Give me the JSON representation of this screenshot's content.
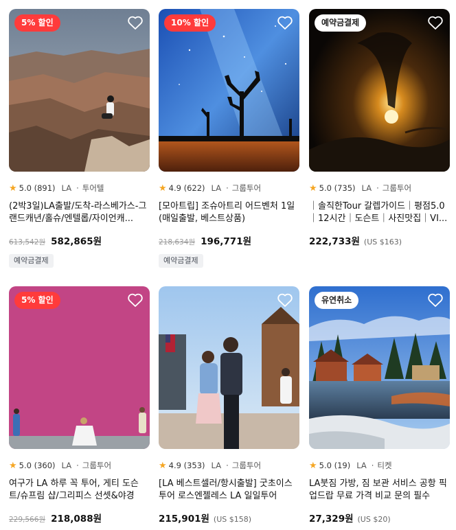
{
  "products": [
    {
      "badge": "5% 할인",
      "rating": "5.0 (891)",
      "city": "LA",
      "category": "투어텔",
      "title": "(2박3일)LA출발/도착-라스베가스-그랜드캐년/홀슈/엔텔롭/자이언캐...",
      "original_price": "613,542원",
      "price": "582,865원",
      "usd": "",
      "tag": "예약금결제"
    },
    {
      "badge": "10% 할인",
      "rating": "4.9 (622)",
      "city": "LA",
      "category": "그룹투어",
      "title": "[모아트립] 조슈아트리 어드벤처 1일 (매일출발, 베스트상품)",
      "original_price": "218,634원",
      "price": "196,771원",
      "usd": "",
      "tag": "예약금결제"
    },
    {
      "badge": "예약금결제",
      "rating": "5.0 (735)",
      "city": "LA",
      "category": "그룹투어",
      "title": "｜솔직한Tour 갈렙가이드｜평점5.0｜12시간｜도슨트｜사진맛집｜VI...",
      "original_price": "",
      "price": "222,733원",
      "usd": "(US $163)",
      "tag": ""
    },
    {
      "badge": "5% 할인",
      "rating": "5.0 (360)",
      "city": "LA",
      "category": "그룹투어",
      "title": "여구가 LA 하루 꼭 투어, 게티 도슨트/슈프림 샵/그리피스 선셋&야경",
      "original_price": "229,566원",
      "price": "218,088원",
      "usd": "",
      "tag": ""
    },
    {
      "badge": "",
      "rating": "4.9 (353)",
      "city": "LA",
      "category": "그룹투어",
      "title": "[LA 베스트셀러/항시출발] 굿초이스 투어 로스엔젤레스 LA 일일투어",
      "original_price": "",
      "price": "215,901원",
      "usd": "(US $158)",
      "tag": ""
    },
    {
      "badge": "유연취소",
      "rating": "5.0 (19)",
      "city": "LA",
      "category": "티켓",
      "title": "LA붓짐 가방, 짐 보관 서비스 공항 픽업드랍 무료 가격 비교 문의 필수",
      "original_price": "",
      "price": "27,329원",
      "usd": "(US $20)",
      "tag": ""
    }
  ],
  "colors": {
    "sale_badge": "#ff3b3b",
    "star": "#f5a623",
    "tag_bg": "#f0f1f3"
  }
}
